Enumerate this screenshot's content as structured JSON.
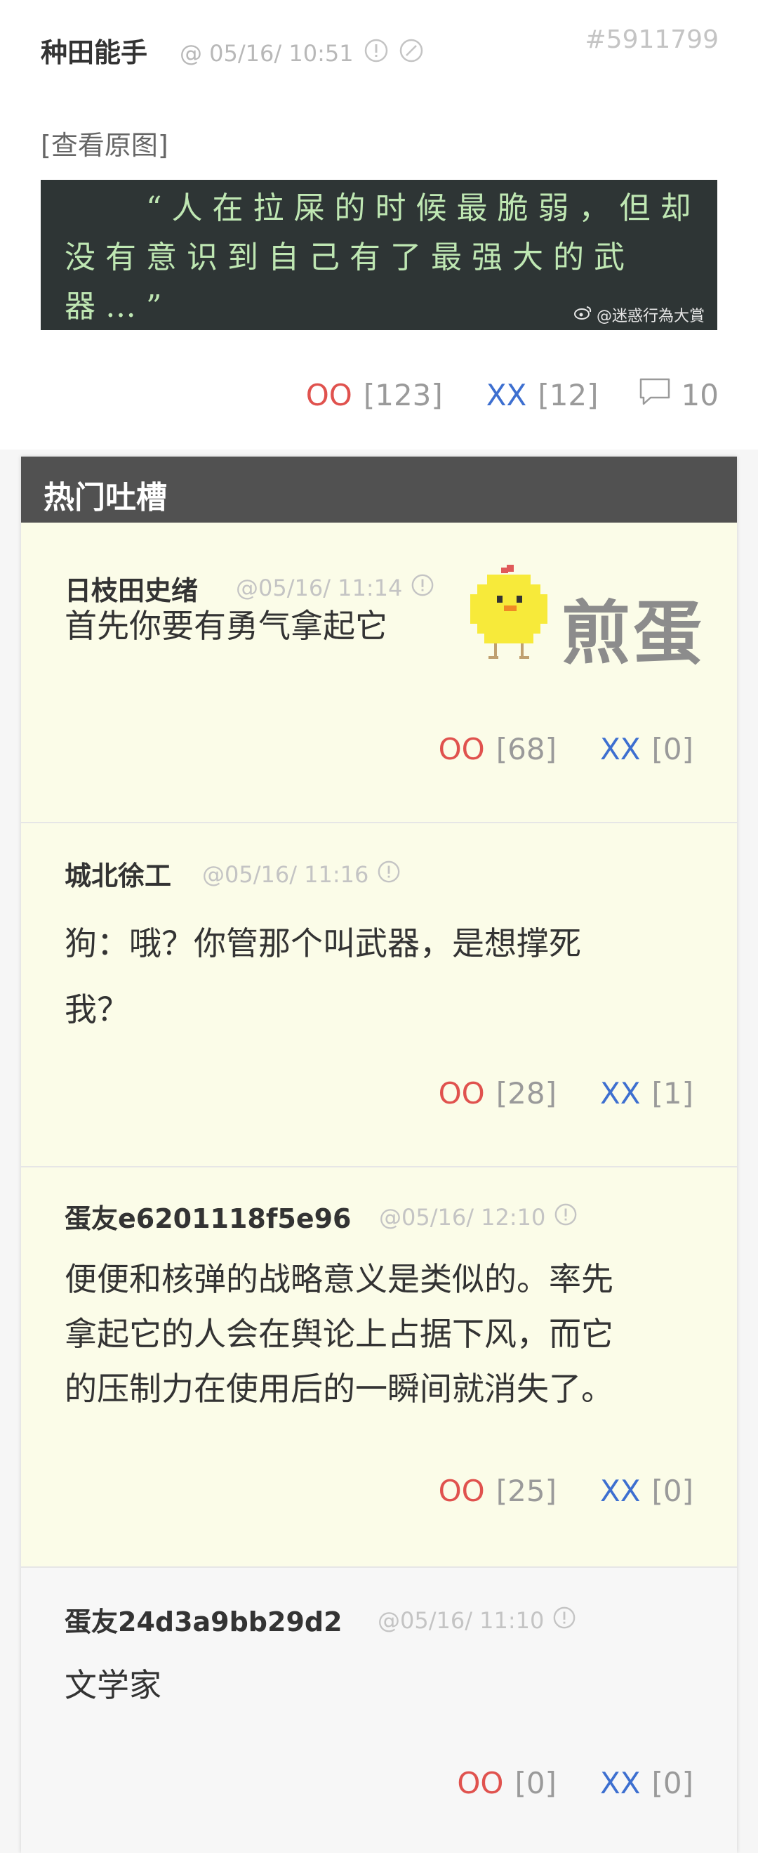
{
  "post": {
    "author": "种田能手",
    "time": "@ 05/16/ 10:51",
    "id": "#5911799",
    "view_original": "[查看原图]",
    "image": {
      "line1": "“人在拉屎的时候最脆弱，但却",
      "line2": "没有意识到自己有了最强大的武",
      "line3": "器…”",
      "watermark": "@迷惑行為大賞"
    },
    "oo_label": "OO",
    "oo_count": "[123]",
    "xx_label": "XX",
    "xx_count": "[12]",
    "comment_count": "10"
  },
  "hot": {
    "title": "热门吐槽",
    "badge_text": "煎蛋",
    "comments": [
      {
        "author": "日枝田史绪",
        "time": "@05/16/ 11:14",
        "lines": [
          "首先你要有勇气拿起它"
        ],
        "oo": "OO",
        "oo_count": "[68]",
        "xx": "XX",
        "xx_count": "[0]"
      },
      {
        "author": "城北徐工",
        "time": "@05/16/ 11:16",
        "lines": [
          "狗：哦？你管那个叫武器，是想撑死",
          "我？"
        ],
        "oo": "OO",
        "oo_count": "[28]",
        "xx": "XX",
        "xx_count": "[1]"
      },
      {
        "author": "蛋友e6201118f5e96",
        "time": "@05/16/ 12:10",
        "lines": [
          "便便和核弹的战略意义是类似的。率先",
          "拿起它的人会在舆论上占据下风，而它",
          "的压制力在使用后的一瞬间就消失了。"
        ],
        "oo": "OO",
        "oo_count": "[25]",
        "xx": "XX",
        "xx_count": "[0]"
      },
      {
        "author": "蛋友24d3a9bb29d2",
        "time": "@05/16/ 11:10",
        "lines": [
          "文学家"
        ],
        "oo": "OO",
        "oo_count": "[0]",
        "xx": "XX",
        "xx_count": "[0]"
      }
    ]
  },
  "colors": {
    "oo": "#e0524e",
    "xx": "#3d6fd0",
    "hot_bg": "#fbfce8",
    "hot_header": "#515151"
  },
  "icons": {
    "report": "exclamation-circle-icon",
    "block": "slash-circle-icon",
    "comment": "speech-bubble-icon",
    "weibo": "weibo-icon",
    "chick": "pixel-chick-icon"
  }
}
